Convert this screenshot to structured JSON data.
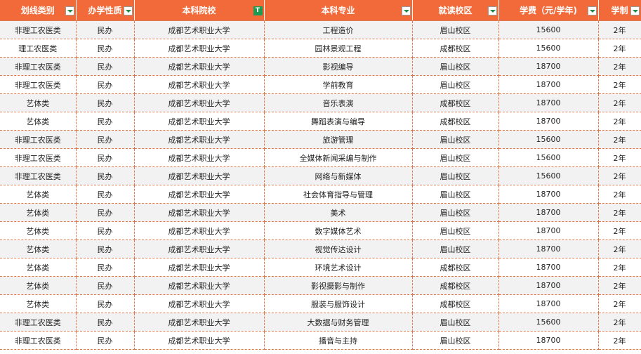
{
  "columns": [
    {
      "label": "划线类别",
      "filter": "normal"
    },
    {
      "label": "办学性质",
      "filter": "normal"
    },
    {
      "label": "本科院校",
      "filter": "active",
      "filter_glyph": "T"
    },
    {
      "label": "本科专业",
      "filter": "normal"
    },
    {
      "label": "就读校区",
      "filter": "normal"
    },
    {
      "label": "学费（元/学年)",
      "filter": "normal"
    },
    {
      "label": "学制",
      "filter": "normal"
    }
  ],
  "rows": [
    [
      "非理工农医类",
      "民办",
      "成都艺术职业大学",
      "工程造价",
      "眉山校区",
      "15600",
      "2年"
    ],
    [
      "理工农医类",
      "民办",
      "成都艺术职业大学",
      "园林景观工程",
      "成都校区",
      "15600",
      "2年"
    ],
    [
      "非理工农医类",
      "民办",
      "成都艺术职业大学",
      "影视编导",
      "眉山校区",
      "18700",
      "2年"
    ],
    [
      "非理工农医类",
      "民办",
      "成都艺术职业大学",
      "学前教育",
      "眉山校区",
      "18700",
      "2年"
    ],
    [
      "艺体类",
      "民办",
      "成都艺术职业大学",
      "音乐表演",
      "成都校区",
      "18700",
      "2年"
    ],
    [
      "艺体类",
      "民办",
      "成都艺术职业大学",
      "舞蹈表演与编导",
      "成都校区",
      "18700",
      "2年"
    ],
    [
      "非理工农医类",
      "民办",
      "成都艺术职业大学",
      "旅游管理",
      "眉山校区",
      "15600",
      "2年"
    ],
    [
      "非理工农医类",
      "民办",
      "成都艺术职业大学",
      "全媒体新闻采编与制作",
      "眉山校区",
      "15600",
      "2年"
    ],
    [
      "非理工农医类",
      "民办",
      "成都艺术职业大学",
      "网络与新媒体",
      "眉山校区",
      "15600",
      "2年"
    ],
    [
      "艺体类",
      "民办",
      "成都艺术职业大学",
      "社会体育指导与管理",
      "眉山校区",
      "18700",
      "2年"
    ],
    [
      "艺体类",
      "民办",
      "成都艺术职业大学",
      "美术",
      "眉山校区",
      "18700",
      "2年"
    ],
    [
      "艺体类",
      "民办",
      "成都艺术职业大学",
      "数字媒体艺术",
      "眉山校区",
      "18700",
      "2年"
    ],
    [
      "艺体类",
      "民办",
      "成都艺术职业大学",
      "视觉传达设计",
      "眉山校区",
      "18700",
      "2年"
    ],
    [
      "艺体类",
      "民办",
      "成都艺术职业大学",
      "环境艺术设计",
      "成都校区",
      "18700",
      "2年"
    ],
    [
      "艺体类",
      "民办",
      "成都艺术职业大学",
      "影视摄影与制作",
      "成都校区",
      "18700",
      "2年"
    ],
    [
      "艺体类",
      "民办",
      "成都艺术职业大学",
      "服装与服饰设计",
      "成都校区",
      "18700",
      "2年"
    ],
    [
      "非理工农医类",
      "民办",
      "成都艺术职业大学",
      "大数据与财务管理",
      "眉山校区",
      "15600",
      "2年"
    ],
    [
      "非理工农医类",
      "民办",
      "成都艺术职业大学",
      "播音与主持",
      "眉山校区",
      "18700",
      "2年"
    ]
  ],
  "colors": {
    "header_bg": "#f26a3a",
    "header_text": "#ffffff",
    "grid_line": "#e0784e",
    "alt_row": "#f2f2f2",
    "filter_active": "#1e9a52"
  }
}
